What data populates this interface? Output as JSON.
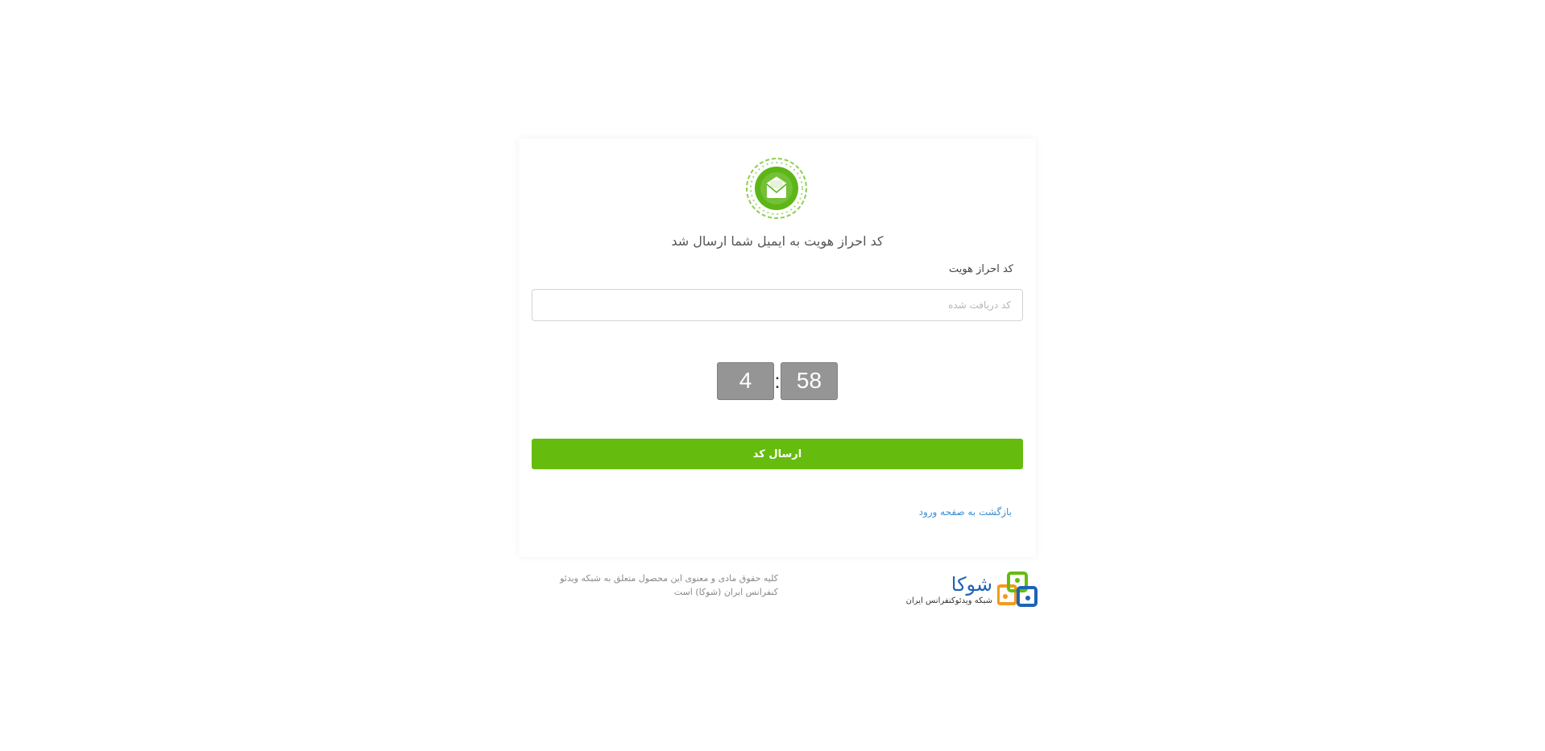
{
  "verification": {
    "heading": "کد احراز هویت به ایمیل شما ارسال شد",
    "field_label": "کد احراز هویت",
    "input_placeholder": "کد دریافت شده",
    "input_value": ""
  },
  "timer": {
    "minutes": "4",
    "separator": ":",
    "seconds": "58"
  },
  "actions": {
    "submit_label": "ارسال کد",
    "back_link_label": "بازگشت به صفحه ورود"
  },
  "footer": {
    "copyright": "کلیه حقوق مادی و معنوی این محصول متعلق به شبکه ویدئو کنفرانس ایران (شوکا) است",
    "brand_name": "شوکا",
    "brand_subtitle": "شبکه ویدئوکنفرانس ایران"
  },
  "icons": {
    "mail_badge": "envelope-icon",
    "brand_logo": "squares-logo"
  },
  "colors": {
    "accent_green": "#65bc0e",
    "timer_gray": "#959595",
    "link_blue": "#3d8fd4",
    "brand_blue": "#1e63b5",
    "brand_orange": "#f39a1e"
  }
}
